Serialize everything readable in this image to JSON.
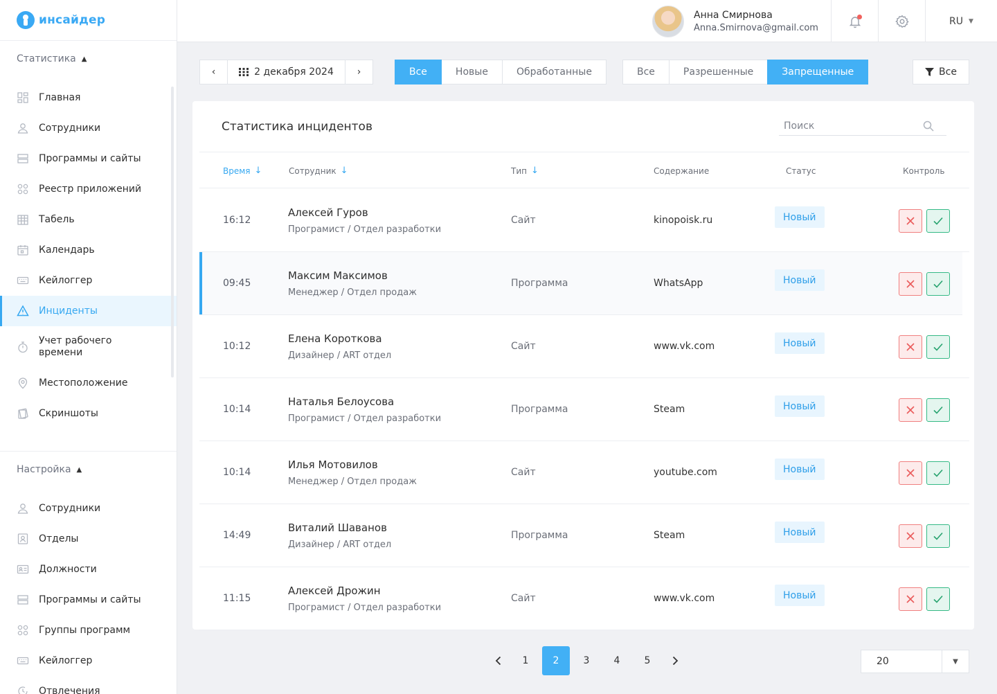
{
  "app": {
    "logo_text": "инсайдер"
  },
  "sidebar": {
    "stats_section": "Статистика",
    "stats_items": [
      {
        "label": "Главная",
        "icon": "dashboard-icon"
      },
      {
        "label": "Сотрудники",
        "icon": "user-icon"
      },
      {
        "label": "Программы и сайты",
        "icon": "programs-icon"
      },
      {
        "label": "Реестр приложений",
        "icon": "apps-registry-icon"
      },
      {
        "label": "Табель",
        "icon": "timesheet-icon"
      },
      {
        "label": "Календарь",
        "icon": "calendar-icon"
      },
      {
        "label": "Кейлоггер",
        "icon": "keyboard-icon"
      },
      {
        "label": "Инциденты",
        "icon": "warning-icon",
        "active": true
      },
      {
        "label": "Учет рабочего времени",
        "icon": "stopwatch-icon"
      },
      {
        "label": "Местоположение",
        "icon": "location-icon"
      },
      {
        "label": "Скриншоты",
        "icon": "screenshots-icon"
      }
    ],
    "settings_section": "Настройка",
    "settings_items": [
      {
        "label": "Сотрудники",
        "icon": "user-icon"
      },
      {
        "label": "Отделы",
        "icon": "department-icon"
      },
      {
        "label": "Должности",
        "icon": "position-icon"
      },
      {
        "label": "Программы и сайты",
        "icon": "programs-icon"
      },
      {
        "label": "Группы программ",
        "icon": "program-groups-icon"
      },
      {
        "label": "Кейлоггер",
        "icon": "keyboard-icon"
      },
      {
        "label": "Отвлечения",
        "icon": "distraction-icon"
      }
    ]
  },
  "header": {
    "user_name": "Анна Смирнова",
    "user_email": "Anna.Smirnova@gmail.com",
    "language": "RU",
    "has_notifications": true
  },
  "filters": {
    "date": "2 декабря 2024",
    "status_tabs": [
      "Все",
      "Новые",
      "Обработанные"
    ],
    "status_active": "Все",
    "access_tabs": [
      "Все",
      "Разрешенные",
      "Запрещенные"
    ],
    "access_active": "Запрещенные",
    "filter_label": "Все"
  },
  "incidents": {
    "title": "Статистика инцидентов",
    "search_placeholder": "Поиск",
    "columns": {
      "time": "Время",
      "employee": "Сотрудник",
      "type": "Тип",
      "content": "Содержание",
      "status": "Статус",
      "control": "Контроль"
    },
    "rows": [
      {
        "time": "16:12",
        "name": "Алексей Гуров",
        "position": "Програмист / Отдел разработки",
        "type": "Сайт",
        "content": "kinopoisk.ru",
        "status": "Новый"
      },
      {
        "time": "09:45",
        "name": "Максим Максимов",
        "position": "Менеджер / Отдел продаж",
        "type": "Программа",
        "content": "WhatsApp",
        "status": "Новый",
        "highlight": true
      },
      {
        "time": "10:12",
        "name": "Елена Короткова",
        "position": "Дизайнер / ART отдел",
        "type": "Сайт",
        "content": "www.vk.com",
        "status": "Новый"
      },
      {
        "time": "10:14",
        "name": "Наталья Белоусова",
        "position": "Програмист / Отдел разработки",
        "type": "Программа",
        "content": "Steam",
        "status": "Новый"
      },
      {
        "time": "10:14",
        "name": "Илья Мотовилов",
        "position": "Менеджер / Отдел продаж",
        "type": "Сайт",
        "content": "youtube.com",
        "status": "Новый"
      },
      {
        "time": "14:49",
        "name": "Виталий Шаванов",
        "position": "Дизайнер / ART отдел",
        "type": "Программа",
        "content": "Steam",
        "status": "Новый"
      },
      {
        "time": "11:15",
        "name": "Алексей Дрожин",
        "position": "Програмист / Отдел разработки",
        "type": "Сайт",
        "content": "www.vk.com",
        "status": "Новый"
      }
    ]
  },
  "pagination": {
    "pages": [
      "1",
      "2",
      "3",
      "4",
      "5"
    ],
    "current": "2",
    "per_page": "20"
  },
  "colors": {
    "accent": "#42b0f5",
    "deny": "#f07f7f",
    "allow": "#34b985"
  }
}
